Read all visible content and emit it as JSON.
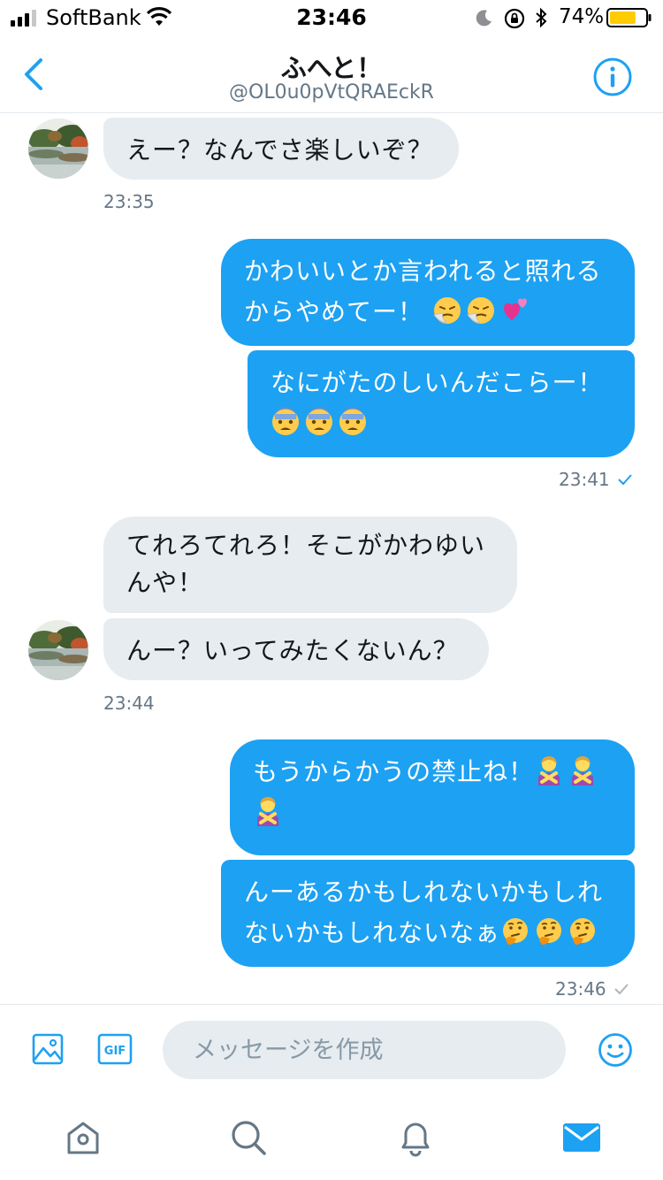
{
  "status_bar": {
    "carrier": "SoftBank",
    "time": "23:46",
    "battery": "74%",
    "battery_level": 0.74
  },
  "header": {
    "title": "ふへと！",
    "handle": "@OL0u0pVtQRAEckR"
  },
  "messages": [
    {
      "direction": "received",
      "text": "えー？なんでさ楽しいぞ？",
      "emojis": []
    },
    {
      "direction": "received_time",
      "time": "23:35"
    },
    {
      "direction": "sent",
      "line1": "かわいいとか言われると照れる",
      "line2": "からやめてー！",
      "emojis": [
        "sneezing-face",
        "sneezing-face",
        "two-hearts"
      ]
    },
    {
      "direction": "sent",
      "line1": "なにがたのしいんだこらー！",
      "emojis": [
        "fearful-face",
        "fearful-face",
        "fearful-face"
      ]
    },
    {
      "direction": "sent_time",
      "time": "23:41"
    },
    {
      "direction": "received",
      "line1": "てれろてれろ！そこがかわゆい",
      "line2": "んや！"
    },
    {
      "direction": "received",
      "text": "んー？いってみたくないん？"
    },
    {
      "direction": "received_time",
      "time": "23:44"
    },
    {
      "direction": "sent",
      "line1": "もうからかうの禁止ね！",
      "emojis": [
        "person-gesturing-no",
        "person-gesturing-no",
        "person-gesturing-no"
      ]
    },
    {
      "direction": "sent",
      "line1": "んーあるかもしれないかもしれ",
      "line2": "ないかもしれないなぁ",
      "emojis": [
        "thinking-face",
        "thinking-face",
        "thinking-face"
      ]
    },
    {
      "direction": "sent_time",
      "time": "23:46"
    }
  ],
  "compose": {
    "placeholder": "メッセージを作成",
    "gif_label": "GIF"
  },
  "tabs": [
    {
      "icon": "home-icon",
      "active": false
    },
    {
      "icon": "search-icon",
      "active": false
    },
    {
      "icon": "notifications-icon",
      "active": false
    },
    {
      "icon": "messages-icon",
      "active": true
    }
  ],
  "colors": {
    "accent": "#1da1f2",
    "received_bubble": "#e6ecf0",
    "secondary_text": "#657786"
  }
}
